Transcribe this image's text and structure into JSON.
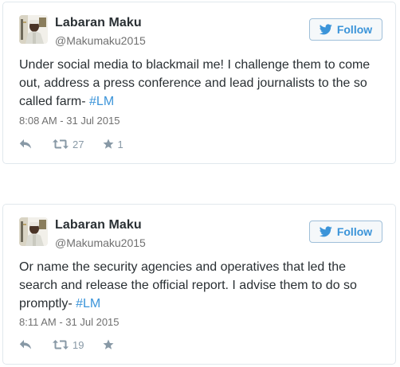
{
  "colors": {
    "accent": "#3b94d9",
    "name": "#292f33",
    "meta": "#707070",
    "action_icons": "#8899a6",
    "border": "#e1e8ed"
  },
  "tweets": [
    {
      "author": {
        "name": "Labaran Maku",
        "handle": "@Makumaku2015",
        "avatar_icon": "profile-photo"
      },
      "follow_label": "Follow",
      "text_main": "Under social media to blackmail me! I challenge them to come out, address a press conference and lead journalists to the so called farm- ",
      "hashtag": "#LM",
      "timestamp": "8:08 AM - 31 Jul 2015",
      "retweets": "27",
      "likes": "1"
    },
    {
      "author": {
        "name": "Labaran Maku",
        "handle": "@Makumaku2015",
        "avatar_icon": "profile-photo"
      },
      "follow_label": "Follow",
      "text_main": "Or name the security agencies and operatives that led the search and release the official report. I advise them to do so promptly- ",
      "hashtag": "#LM",
      "timestamp": "8:11 AM - 31 Jul 2015",
      "retweets": "19",
      "likes": ""
    }
  ]
}
